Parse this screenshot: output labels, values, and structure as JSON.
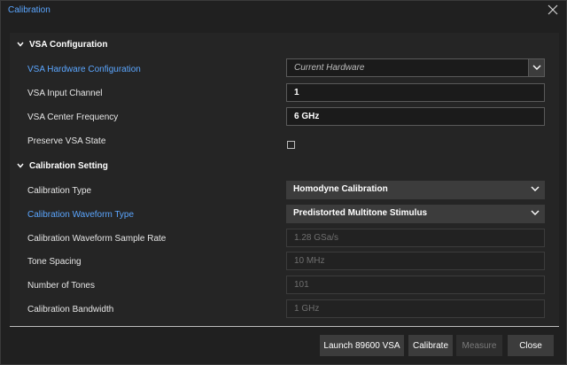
{
  "window": {
    "title": "Calibration"
  },
  "sections": {
    "vsa": "VSA Configuration",
    "calib": "Calibration Setting"
  },
  "fields": {
    "hw_config": {
      "label": "VSA Hardware Configuration",
      "value": "Current Hardware"
    },
    "input_channel": {
      "label": "VSA Input Channel",
      "value": "1"
    },
    "center_freq": {
      "label": "VSA Center Frequency",
      "value": "6 GHz"
    },
    "preserve_state": {
      "label": "Preserve VSA State",
      "checked": false
    },
    "calib_type": {
      "label": "Calibration Type",
      "value": "Homodyne Calibration"
    },
    "waveform_type": {
      "label": "Calibration Waveform Type",
      "value": "Predistorted Multitone Stimulus"
    },
    "sample_rate": {
      "label": "Calibration Waveform Sample Rate",
      "value": "1.28 GSa/s"
    },
    "tone_spacing": {
      "label": "Tone Spacing",
      "value": "10 MHz"
    },
    "num_tones": {
      "label": "Number of Tones",
      "value": "101"
    },
    "bandwidth": {
      "label": "Calibration Bandwidth",
      "value": "1 GHz"
    }
  },
  "buttons": {
    "launch": "Launch 89600 VSA",
    "calibrate": "Calibrate",
    "measure": "Measure",
    "close": "Close"
  },
  "colors": {
    "accent": "#5ba6ff",
    "background": "#202020",
    "panel": "#252525"
  }
}
